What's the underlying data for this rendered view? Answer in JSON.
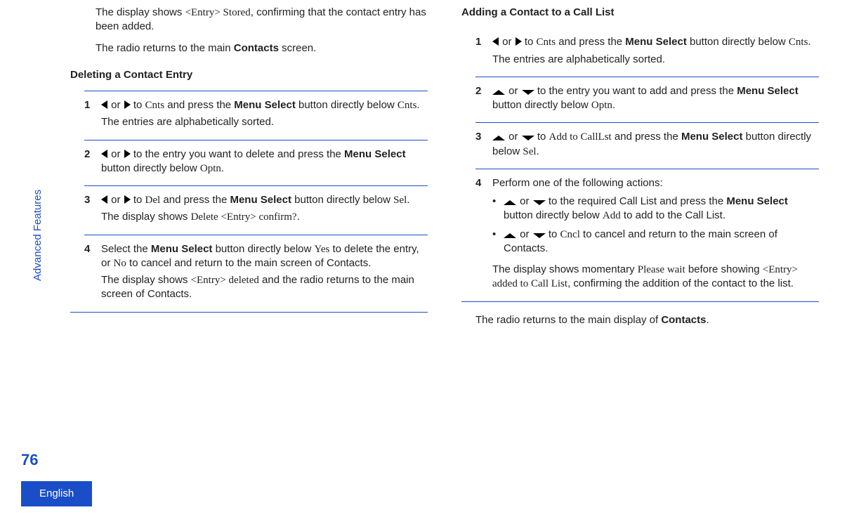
{
  "sideLabel": "Advanced Features",
  "pageNumber": "76",
  "langTab": "English",
  "left": {
    "introA_pre": "The display shows ",
    "introA_code": "<Entry> Stored",
    "introA_post": ", confirming that the contact entry has been added.",
    "introB_pre": "The radio returns to the main ",
    "introB_bold": "Contacts",
    "introB_post": " screen.",
    "heading": "Deleting a Contact Entry",
    "s1_a": " or ",
    "s1_b": " to ",
    "s1_cnts": "Cnts",
    "s1_c": " and press the ",
    "s1_ms": "Menu Select",
    "s1_d": " button directly below ",
    "s1_cnts2": "Cnts",
    "s1_e": ".",
    "s1_line2": "The entries are alphabetically sorted.",
    "s2_a": " or ",
    "s2_b": " to the entry you want to delete and press the ",
    "s2_ms": "Menu Select",
    "s2_c": " button directly below ",
    "s2_optn": "Optn",
    "s2_d": ".",
    "s3_a": " or ",
    "s3_b": " to ",
    "s3_del": "Del",
    "s3_c": " and press the ",
    "s3_ms": "Menu Select",
    "s3_d": " button directly below ",
    "s3_sel": "Sel",
    "s3_e": ".",
    "s3_line2_pre": "The display shows ",
    "s3_line2_code": "Delete <Entry> confirm?",
    "s3_line2_post": ".",
    "s4_a": "Select the ",
    "s4_ms": "Menu Select",
    "s4_b": " button directly below ",
    "s4_yes": "Yes",
    "s4_c": " to delete the entry, or ",
    "s4_no": "No",
    "s4_d": " to cancel and return to the main screen of Contacts.",
    "s4_line2_pre": "The display shows ",
    "s4_line2_code": "<Entry> deleted",
    "s4_line2_post": " and the radio returns to the main screen of Contacts."
  },
  "right": {
    "heading": "Adding a Contact to a Call List",
    "s1_a": " or ",
    "s1_b": " to ",
    "s1_cnts": "Cnts",
    "s1_c": " and press the ",
    "s1_ms": "Menu Select",
    "s1_d": " button directly below ",
    "s1_cnts2": "Cnts",
    "s1_e": ".",
    "s1_line2": "The entries are alphabetically sorted.",
    "s2_a": " or ",
    "s2_b": " to the entry you want to add and press the ",
    "s2_ms": "Menu Select",
    "s2_c": " button directly below ",
    "s2_optn": "Optn",
    "s2_d": ".",
    "s3_a": " or ",
    "s3_b": " to ",
    "s3_add": "Add to CallLst",
    "s3_c": " and press the ",
    "s3_ms": "Menu Select",
    "s3_d": " button directly below ",
    "s3_sel": "Sel",
    "s3_e": ".",
    "s4_intro": "Perform one of the following actions:",
    "b1_a": " or ",
    "b1_b": " to the required Call List and press the ",
    "b1_ms": "Menu Select",
    "b1_c": " button directly below ",
    "b1_add": "Add",
    "b1_d": " to add to the Call List.",
    "b2_a": " or ",
    "b2_b": " to ",
    "b2_cncl": "Cncl",
    "b2_c": " to cancel and return to the main screen of Contacts.",
    "s4_tail_pre": "The display shows momentary ",
    "s4_tail_code1": "Please wait",
    "s4_tail_mid": " before showing ",
    "s4_tail_code2": "<Entry> added to Call List",
    "s4_tail_post": ", confirming the addition of the contact to the list.",
    "trail_pre": "The radio returns to the main display of ",
    "trail_bold": "Contacts",
    "trail_post": "."
  }
}
